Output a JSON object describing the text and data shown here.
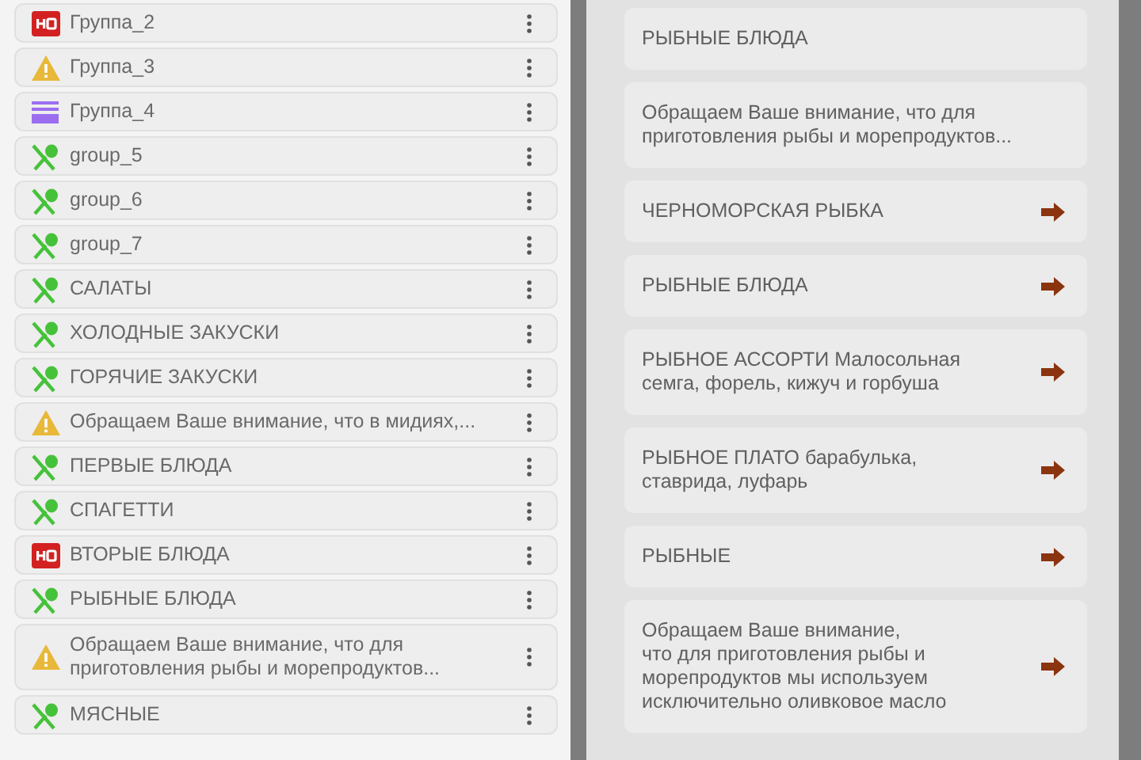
{
  "groups": [
    {
      "kind": "badge",
      "label": "Группа_2"
    },
    {
      "kind": "warning",
      "label": "Группа_3"
    },
    {
      "kind": "lines",
      "label": "Группа_4"
    },
    {
      "kind": "food",
      "label": "group_5"
    },
    {
      "kind": "food",
      "label": "group_6"
    },
    {
      "kind": "food",
      "label": "group_7"
    },
    {
      "kind": "food",
      "label": "САЛАТЫ"
    },
    {
      "kind": "food",
      "label": "ХОЛОДНЫЕ ЗАКУСКИ"
    },
    {
      "kind": "food",
      "label": "ГОРЯЧИЕ ЗАКУСКИ"
    },
    {
      "kind": "warning",
      "label": "Обращаем Ваше внимание, что в мидиях,..."
    },
    {
      "kind": "food",
      "label": "ПЕРВЫЕ БЛЮДА"
    },
    {
      "kind": "food",
      "label": "СПАГЕТТИ"
    },
    {
      "kind": "badge",
      "label": "ВТОРЫЕ БЛЮДА"
    },
    {
      "kind": "food",
      "label": "РЫБНЫЕ БЛЮДА"
    },
    {
      "kind": "warning",
      "label": "Обращаем Ваше внимание, что для\nприготовления рыбы и морепродуктов..."
    },
    {
      "kind": "food",
      "label": "МЯСНЫЕ"
    }
  ],
  "submenu": [
    {
      "label": "РЫБНЫЕ БЛЮДА",
      "arrow": false
    },
    {
      "label": "Обращаем Ваше внимание, что для\nприготовления рыбы и морепродуктов...",
      "arrow": false
    },
    {
      "label": "ЧЕРНОМОРСКАЯ РЫБКА",
      "arrow": true
    },
    {
      "label": "РЫБНЫЕ БЛЮДА",
      "arrow": true
    },
    {
      "label": "РЫБНОЕ АССОРТИ Малосольная\nсемга, форель, кижуч и горбуша",
      "arrow": true
    },
    {
      "label": "РЫБНОЕ ПЛАТО барабулька,\nставрида, луфарь",
      "arrow": true
    },
    {
      "label": "РЫБНЫЕ",
      "arrow": true
    },
    {
      "label": "Обращаем Ваше внимание,\nчто для приготовления рыбы и\nморепродуктов мы используем\nисключительно оливковое масло",
      "arrow": true
    }
  ]
}
